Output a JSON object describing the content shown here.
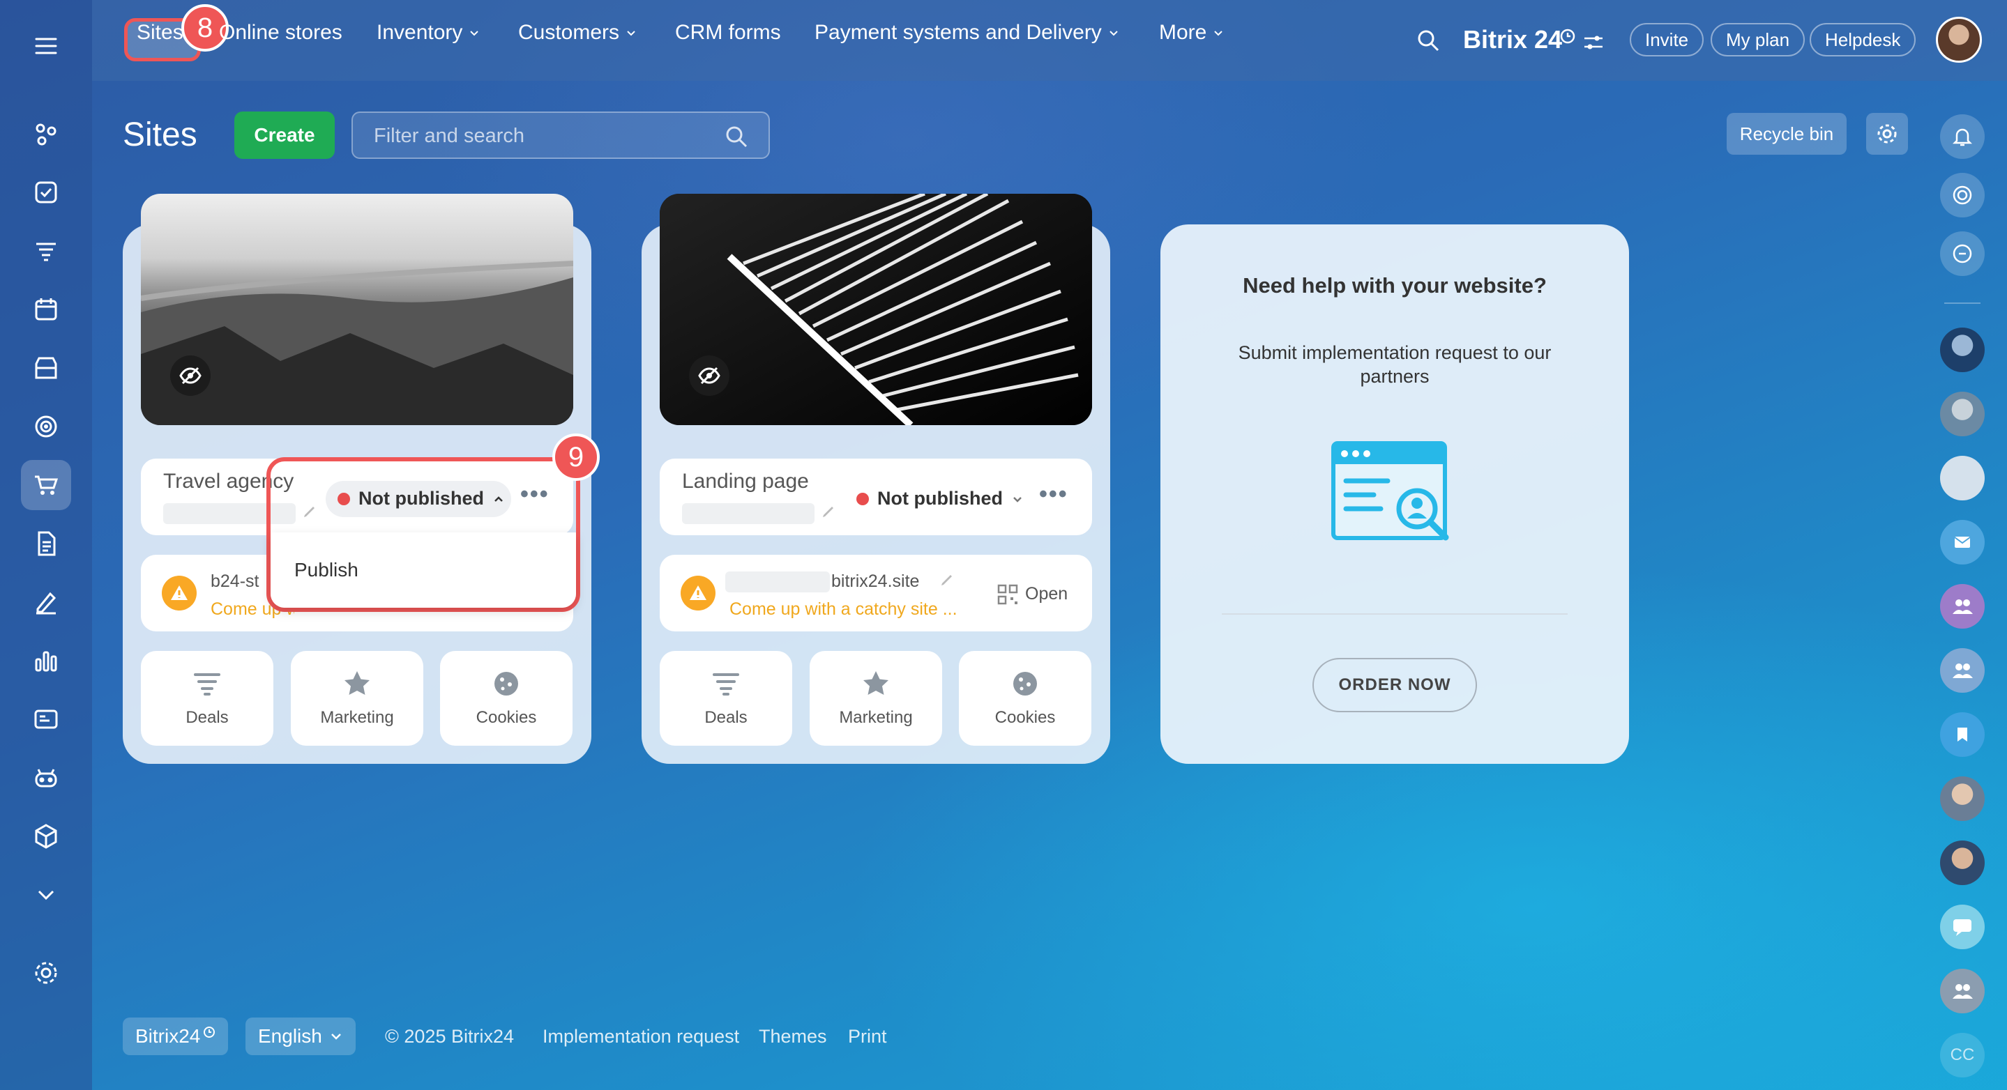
{
  "nav": {
    "sites": "Sites",
    "online_stores": "Online stores",
    "inventory": "Inventory",
    "customers": "Customers",
    "crm_forms": "CRM forms",
    "payment": "Payment systems and Delivery",
    "more": "More",
    "brand": "Bitrix 24",
    "invite": "Invite",
    "my_plan": "My plan",
    "helpdesk": "Helpdesk"
  },
  "page": {
    "title": "Sites",
    "create": "Create",
    "search_placeholder": "Filter and search",
    "recycle": "Recycle bin"
  },
  "badges": {
    "b8": "8",
    "b9": "9"
  },
  "card1": {
    "title": "Travel agency",
    "status": "Not published",
    "domain": "b24-st",
    "hint": "Come up with a catchy site ...",
    "menu_publish": "Publish",
    "deals": "Deals",
    "marketing": "Marketing",
    "cookies": "Cookies"
  },
  "card2": {
    "title": "Landing page",
    "status": "Not published",
    "domain": "bitrix24.site",
    "hint": "Come up with a catchy site ...",
    "open": "Open",
    "deals": "Deals",
    "marketing": "Marketing",
    "cookies": "Cookies"
  },
  "help": {
    "title": "Need help with your website?",
    "text": "Submit implementation request to our partners",
    "button": "ORDER NOW"
  },
  "footer": {
    "brand": "Bitrix24",
    "language": "English",
    "copyright": "© 2025 Bitrix24",
    "impl": "Implementation request",
    "themes": "Themes",
    "print": "Print"
  },
  "rightbar": {
    "cc": "CC"
  },
  "colors": {
    "accent_green": "#1fab54",
    "status_red": "#e84d4d",
    "warning": "#f9a825",
    "highlight": "#ef5656"
  }
}
